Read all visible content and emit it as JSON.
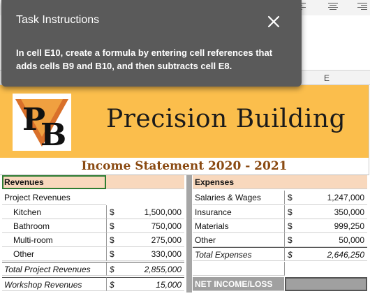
{
  "dialog": {
    "title": "Task Instructions",
    "close_icon": "close-icon",
    "body": "In cell E10, create a formula by entering cell references that adds cells B9 and B10, and then subtracts cell E8."
  },
  "column_header_e": "E",
  "banner": {
    "company": "Precision Building",
    "logo_text": "PB",
    "accent_color": "#fbbe4c"
  },
  "statement_title": "Income Statement 2020 - 2021",
  "revenues": {
    "header": "Revenues",
    "group_label": "Project Revenues",
    "rows": [
      {
        "label": "Kitchen",
        "cur": "$",
        "value": "1,500,000"
      },
      {
        "label": "Bathroom",
        "cur": "$",
        "value": "750,000"
      },
      {
        "label": "Multi-room",
        "cur": "$",
        "value": "275,000"
      },
      {
        "label": "Other",
        "cur": "$",
        "value": "330,000"
      }
    ],
    "total_project": {
      "label": "Total Project Revenues",
      "cur": "$",
      "value": "2,855,000"
    },
    "workshop": {
      "label": "Workshop Revenues",
      "cur": "$",
      "value": "15,000"
    }
  },
  "expenses": {
    "header": "Expenses",
    "rows": [
      {
        "label": "Salaries & Wages",
        "cur": "$",
        "value": "1,247,000"
      },
      {
        "label": "Insurance",
        "cur": "$",
        "value": "350,000"
      },
      {
        "label": "Materials",
        "cur": "$",
        "value": "999,250"
      },
      {
        "label": "Other",
        "cur": "$",
        "value": "50,000"
      }
    ],
    "total": {
      "label": "Total Expenses",
      "cur": "$",
      "value": "2,646,250"
    },
    "net_income_label": "NET INCOME/LOSS"
  }
}
